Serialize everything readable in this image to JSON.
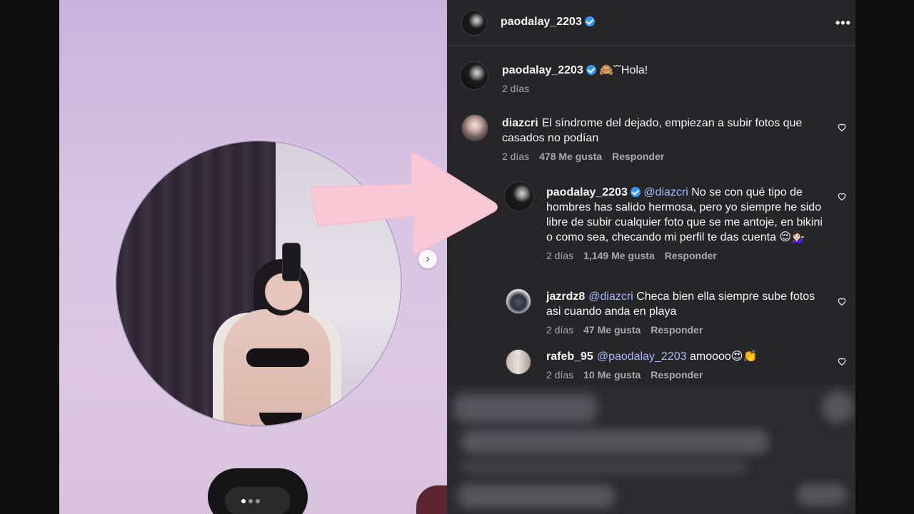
{
  "post": {
    "author": "paodalay_2203",
    "caption_emoji": "🙈",
    "caption_text": "˘˘Hola!",
    "caption_age": "2 días",
    "carousel": {
      "current_slide": 1,
      "total_slides": 3
    }
  },
  "header": {
    "username": "paodalay_2203",
    "more_label": "•••"
  },
  "comments": [
    {
      "username": "diazcri",
      "text": "El síndrome del dejado, empiezan a subir fotos que casados no podían",
      "age": "2 días",
      "likes": "478 Me gusta",
      "reply_label": "Responder"
    },
    {
      "username": "paodalay_2203",
      "mention": "@diazcri",
      "text": "No se con qué tipo de hombres has salido hermosa, pero yo siempre he sido libre de subir cualquier foto que se me antoje, en bikini o como sea, checando mi perfil te das cuenta 😌💁🏻‍♀️",
      "age": "2 días",
      "likes": "1,149 Me gusta",
      "reply_label": "Responder"
    },
    {
      "username": "jazrdz8",
      "mention": "@diazcri",
      "text": "Checa bien ella siempre sube fotos asi cuando anda en playa",
      "age": "2 días",
      "likes": "47 Me gusta",
      "reply_label": "Responder"
    },
    {
      "username": "rafeb_95",
      "mention": "@paodalay_2203",
      "text": "amoooo😍👏",
      "age": "2 días",
      "likes": "10 Me gusta",
      "reply_label": "Responder"
    }
  ],
  "colors": {
    "panel_bg": "#262629",
    "mention": "#a9b6ff",
    "verified": "#3897f0",
    "arrow": "#f9c9d8"
  },
  "icons": {
    "verified": "verified-badge-icon",
    "heart": "heart-outline-icon",
    "next": "chevron-right-icon",
    "more": "more-horizontal-icon"
  }
}
